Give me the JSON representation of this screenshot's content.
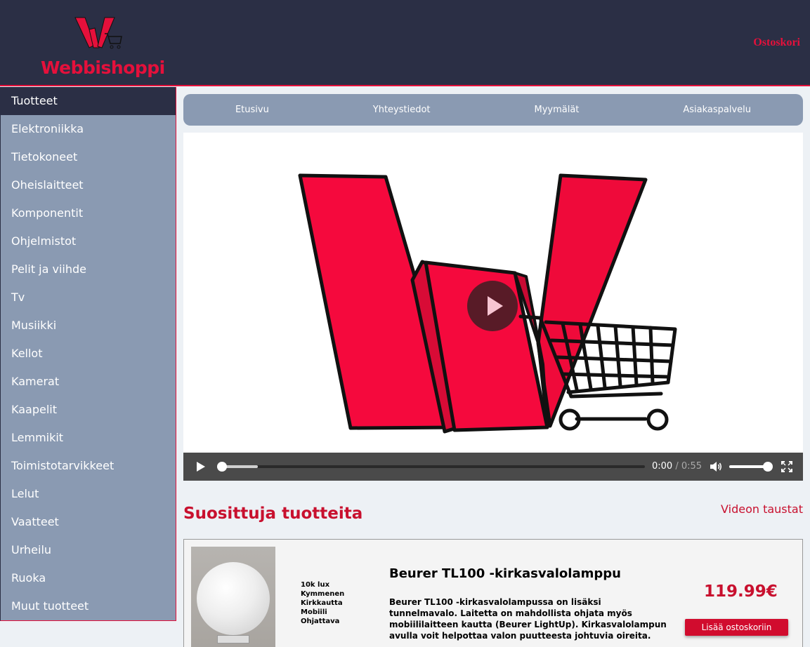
{
  "header": {
    "logo_text": "Webbishoppi",
    "cart_label": "Ostoskori"
  },
  "sidebar": {
    "items": [
      {
        "label": "Tuotteet",
        "active": true
      },
      {
        "label": "Elektroniikka"
      },
      {
        "label": "Tietokoneet"
      },
      {
        "label": "Oheislaitteet"
      },
      {
        "label": "Komponentit"
      },
      {
        "label": "Ohjelmistot"
      },
      {
        "label": "Pelit ja viihde"
      },
      {
        "label": "Tv"
      },
      {
        "label": "Musiikki"
      },
      {
        "label": "Kellot"
      },
      {
        "label": "Kamerat"
      },
      {
        "label": "Kaapelit"
      },
      {
        "label": "Lemmikit"
      },
      {
        "label": "Toimistotarvikkeet"
      },
      {
        "label": "Lelut"
      },
      {
        "label": "Vaatteet"
      },
      {
        "label": "Urheilu"
      },
      {
        "label": "Ruoka"
      },
      {
        "label": "Muut tuotteet"
      }
    ]
  },
  "topnav": {
    "items": [
      "Etusivu",
      "Yhteystiedot",
      "Myymälät",
      "Asiakaspalvelu"
    ]
  },
  "video": {
    "current_time": "0:00",
    "duration": "0:55",
    "buffered_fraction": 0.09,
    "played_fraction": 0.0,
    "volume_fraction": 0.95
  },
  "section": {
    "title": "Suosittuja tuotteita",
    "video_link": "Videon taustat"
  },
  "product": {
    "features": [
      "10k lux",
      "Kymmenen",
      "Kirkkautta",
      "Mobiili",
      "Ohjattava"
    ],
    "name": "Beurer TL100 -kirkasvalolamppu",
    "description": "Beurer TL100 -kirkasvalolampussa on lisäksi tunnelmavalo. Laitetta on mahdollista ohjata myös mobiililaitteen kautta (Beurer LightUp). Kirkasvalolampun avulla voit helpottaa valon puutteesta johtuvia oireita.",
    "price": "119.99€",
    "add_button": "Lisää ostoskoriin"
  },
  "colors": {
    "brand_red": "#e5103b",
    "header_bg": "#2b2f45",
    "sidebar_bg": "#8a9ab2",
    "page_bg": "#edf1f5"
  }
}
